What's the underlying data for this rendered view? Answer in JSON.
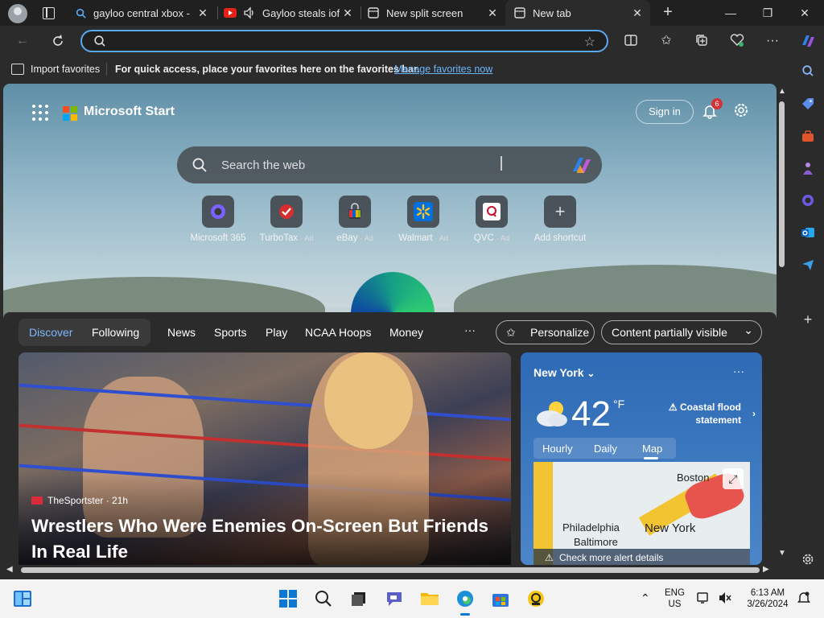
{
  "tabs": [
    {
      "title": "gayloo central xbox -",
      "favicon": "search-icon"
    },
    {
      "title": "Gayloo steals iof",
      "favicon": "youtube-icon",
      "audio": "speaker-icon"
    },
    {
      "title": "New split screen",
      "favicon": "newtab-icon"
    },
    {
      "title": "New tab",
      "favicon": "newtab-icon",
      "active": true
    }
  ],
  "address": {
    "value": "",
    "placeholder": ""
  },
  "favorites_bar": {
    "import_label": "Import favorites",
    "hint": "For quick access, place your favorites here on the favorites bar.",
    "manage_link": "Manage favorites now"
  },
  "newtab": {
    "brand": "Microsoft Start",
    "sign_in": "Sign in",
    "notification_count": "6",
    "search_placeholder": "Search the web",
    "shortcuts": [
      {
        "label": "Microsoft 365",
        "ad": ""
      },
      {
        "label": "TurboTax",
        "ad": "· Ad"
      },
      {
        "label": "eBay",
        "ad": "· Ad"
      },
      {
        "label": "Walmart",
        "ad": "· Ad"
      },
      {
        "label": "QVC",
        "ad": "· Ad"
      },
      {
        "label": "Add shortcut",
        "ad": ""
      }
    ]
  },
  "feed": {
    "nav": [
      "Discover",
      "Following",
      "News",
      "Sports",
      "Play",
      "NCAA Hoops",
      "Money"
    ],
    "more": "···",
    "personalize": "Personalize",
    "content_visibility": "Content partially visible"
  },
  "story": {
    "source": "TheSportster · 21h",
    "headline": "Wrestlers Who Were Enemies On-Screen But Friends In Real Life"
  },
  "weather": {
    "location": "New York",
    "temperature": "42",
    "unit": "°F",
    "alert": "Coastal flood statement",
    "tabs": [
      "Hourly",
      "Daily",
      "Map"
    ],
    "selected_tab": "Map",
    "map_labels": {
      "boston": "Boston",
      "philadelphia": "Philadelphia",
      "new_york": "New York",
      "baltimore": "Baltimore"
    },
    "alert_link": "Check more alert details"
  },
  "taskbar": {
    "lang_line1": "ENG",
    "lang_line2": "US",
    "time": "6:13 AM",
    "date": "3/26/2024"
  },
  "colors": {
    "accent": "#5aa9f0",
    "link": "#6cb6ff",
    "badge": "#d13438"
  }
}
